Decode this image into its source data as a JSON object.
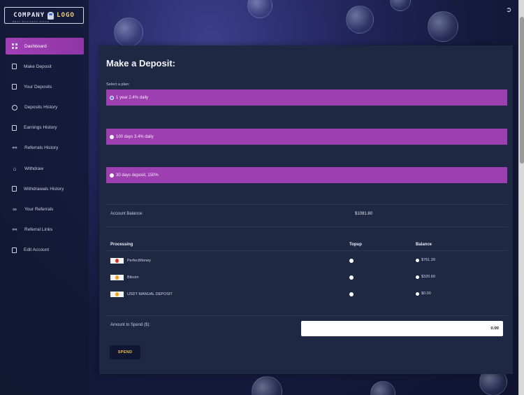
{
  "brand": {
    "word1": "COMPANY",
    "word2": "LOGO",
    "tagline": "BEST BUSINESS SINCE"
  },
  "sidebar": {
    "items": [
      {
        "label": "Dashboard",
        "icon": "dashboard-icon",
        "active": true
      },
      {
        "label": "Make Deposit",
        "icon": "document-icon"
      },
      {
        "label": "Your Deposits",
        "icon": "list-icon"
      },
      {
        "label": "Deposits History",
        "icon": "clock-icon"
      },
      {
        "label": "Earnings History",
        "icon": "ledger-icon"
      },
      {
        "label": "Referrals History",
        "icon": "handshake-icon"
      },
      {
        "label": "Withdraw",
        "icon": "bank-icon"
      },
      {
        "label": "Withdrawals History",
        "icon": "chart-icon"
      },
      {
        "label": "Your Referrals",
        "icon": "link-icon"
      },
      {
        "label": "Referral Links",
        "icon": "handshake-icon"
      },
      {
        "label": "Edit Account",
        "icon": "user-card-icon"
      }
    ]
  },
  "header": {
    "logout_icon": "logout-icon"
  },
  "main": {
    "title": "Make a Deposit:",
    "plan_label": "Select a plan:",
    "plans": [
      {
        "label": "1 year 2.4% daily",
        "checked": true
      },
      {
        "label": "100 days 3.4% daily",
        "checked": false
      },
      {
        "label": "30 days deposit, 150%",
        "checked": false
      }
    ],
    "account_balance_label": "Account Balance:",
    "account_balance_value": "$1081.80",
    "table": {
      "headers": [
        "Processing",
        "Topup",
        "Balance"
      ],
      "rows": [
        {
          "processor": "PerfectMoney",
          "balance": "$761.39"
        },
        {
          "processor": "Bitcoin",
          "balance": "$320.60"
        },
        {
          "processor": "USDT MANUAL DEPOSIT",
          "balance": "$0.00"
        }
      ]
    },
    "amount_label": "Amount to Spend ($):",
    "amount_value": "0.00",
    "spend_label": "SPEND"
  },
  "colors": {
    "accent_purple": "#9d3eb1",
    "panel_bg": "#1f2842",
    "button_text": "#f1c23b"
  }
}
